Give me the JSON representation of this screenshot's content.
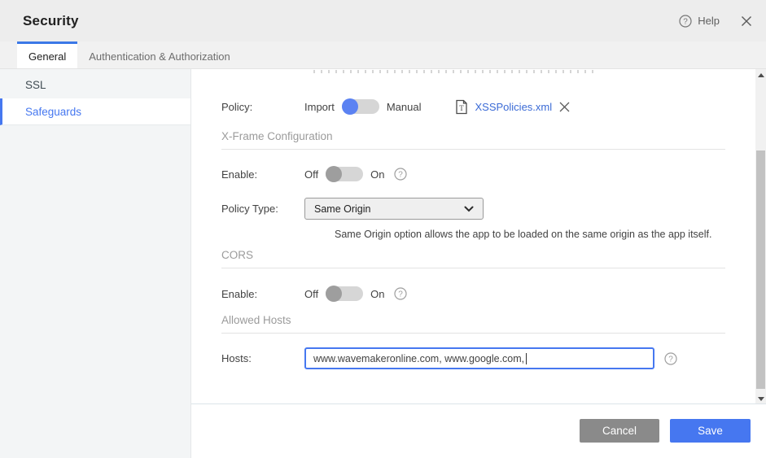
{
  "header": {
    "title": "Security",
    "help_label": "Help"
  },
  "tabs": [
    {
      "label": "General",
      "active": true
    },
    {
      "label": "Authentication & Authorization",
      "active": false
    }
  ],
  "sidebar": {
    "items": [
      {
        "label": "SSL",
        "active": false
      },
      {
        "label": "Safeguards",
        "active": true
      }
    ]
  },
  "content": {
    "policy": {
      "label": "Policy:",
      "option_left": "Import",
      "option_right": "Manual",
      "selected": "Import",
      "file_name": "XSSPolicies.xml"
    },
    "xframe": {
      "title": "X-Frame Configuration",
      "enable_label": "Enable:",
      "toggle_off": "Off",
      "toggle_on": "On",
      "enabled": "Off",
      "policy_type_label": "Policy Type:",
      "policy_type_value": "Same Origin",
      "helper_text": "Same Origin option allows the app to be loaded on the same origin as the app itself."
    },
    "cors": {
      "title": "CORS",
      "enable_label": "Enable:",
      "toggle_off": "Off",
      "toggle_on": "On",
      "enabled": "Off"
    },
    "allowed_hosts": {
      "title": "Allowed Hosts",
      "hosts_label": "Hosts:",
      "hosts_value": "www.wavemakeronline.com, www.google.com, "
    }
  },
  "footer": {
    "cancel_label": "Cancel",
    "save_label": "Save"
  },
  "colors": {
    "accent_blue": "#4678f0",
    "tab_indicator": "#3b78e7",
    "link_blue": "#3b6bd6",
    "toggle_on_blue": "#5b82f2",
    "toggle_off_gray": "#9e9e9e",
    "cancel_gray": "#8a8a8a",
    "save_blue": "#4677f0",
    "header_bg": "#ededed",
    "sidebar_bg": "#f3f5f6"
  }
}
